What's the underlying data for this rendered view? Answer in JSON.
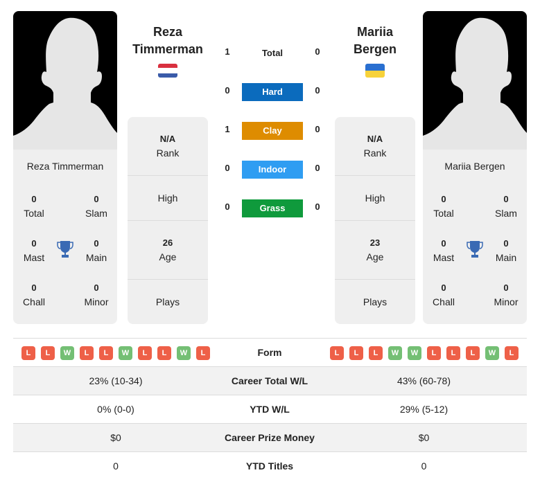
{
  "colors": {
    "hard": "#0b6bbd",
    "clay": "#de8c00",
    "indoor": "#2f9df2",
    "grass": "#0f9a3c",
    "loss": "#ee6048",
    "win": "#74bf74",
    "trophy": "#3a6ab4"
  },
  "player1": {
    "name_line1": "Reza",
    "name_line2": "Timmerman",
    "full_name": "Reza Timmerman",
    "flag": "netherlands-flag",
    "titles": {
      "total": "0",
      "slam": "0",
      "mast": "0",
      "main": "0",
      "chall": "0",
      "minor": "0"
    },
    "rank_value": "N/A",
    "age_value": "26",
    "form": [
      "L",
      "L",
      "W",
      "L",
      "L",
      "W",
      "L",
      "L",
      "W",
      "L"
    ],
    "career_wl": "23% (10-34)",
    "ytd_wl": "0% (0-0)",
    "prize_money": "$0",
    "ytd_titles": "0"
  },
  "player2": {
    "name_line1": "Mariia",
    "name_line2": "Bergen",
    "full_name": "Mariia Bergen",
    "flag": "ukraine-flag",
    "titles": {
      "total": "0",
      "slam": "0",
      "mast": "0",
      "main": "0",
      "chall": "0",
      "minor": "0"
    },
    "rank_value": "N/A",
    "age_value": "23",
    "form": [
      "L",
      "L",
      "L",
      "W",
      "W",
      "L",
      "L",
      "L",
      "W",
      "L"
    ],
    "career_wl": "43% (60-78)",
    "ytd_wl": "29% (5-12)",
    "prize_money": "$0",
    "ytd_titles": "0"
  },
  "labels": {
    "total": "Total",
    "slam": "Slam",
    "mast": "Mast",
    "main": "Main",
    "chall": "Chall",
    "minor": "Minor",
    "rank": "Rank",
    "high": "High",
    "age": "Age",
    "plays": "Plays"
  },
  "h2h": {
    "total_label": "Total",
    "total": {
      "p1": "1",
      "p2": "0"
    },
    "surfaces": [
      {
        "label": "Hard",
        "p1": "0",
        "p2": "0"
      },
      {
        "label": "Clay",
        "p1": "1",
        "p2": "0"
      },
      {
        "label": "Indoor",
        "p1": "0",
        "p2": "0"
      },
      {
        "label": "Grass",
        "p1": "0",
        "p2": "0"
      }
    ]
  },
  "table": {
    "form_label": "Form",
    "career_wl_label": "Career Total W/L",
    "ytd_wl_label": "YTD W/L",
    "prize_label": "Career Prize Money",
    "ytd_titles_label": "YTD Titles"
  }
}
